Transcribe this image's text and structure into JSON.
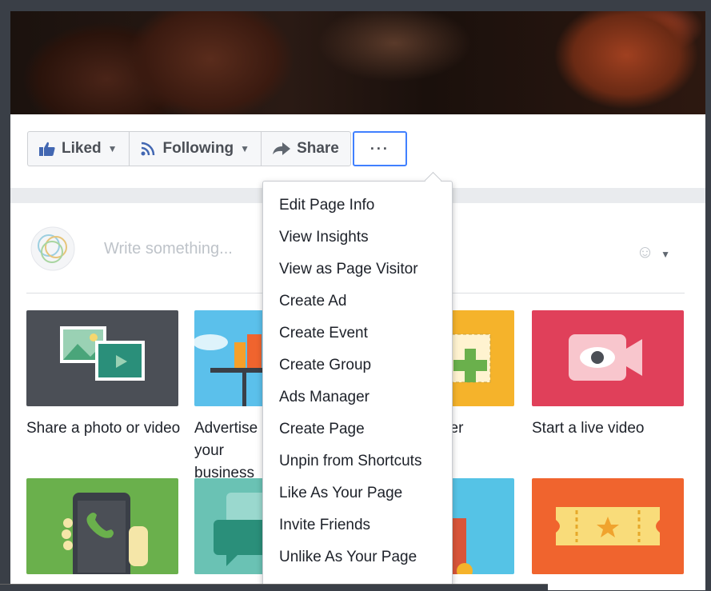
{
  "actions": {
    "liked": "Liked",
    "following": "Following",
    "share": "Share",
    "more": "···"
  },
  "composer": {
    "placeholder": "Write something..."
  },
  "tiles": [
    {
      "label": "Share a photo or video",
      "color": "#4b4f56"
    },
    {
      "label": "Advertise your business",
      "color": "#5bc0eb"
    },
    {
      "label": "Create an offer",
      "color": "#f5b32b"
    },
    {
      "label": "Start a live video",
      "color": "#e0405a"
    },
    {
      "label": "",
      "color": "#6ab04c"
    },
    {
      "label": "",
      "color": "#6ac2b4"
    },
    {
      "label": "",
      "color": "#55c3e6"
    },
    {
      "label": "",
      "color": "#f0642e"
    }
  ],
  "menu": {
    "items": [
      "Edit Page Info",
      "View Insights",
      "View as Page Visitor",
      "Create Ad",
      "Create Event",
      "Create Group",
      "Ads Manager",
      "Create Page",
      "Unpin from Shortcuts",
      "Like As Your Page",
      "Invite Friends",
      "Unlike As Your Page"
    ]
  }
}
